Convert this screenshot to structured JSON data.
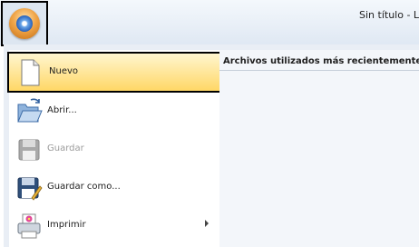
{
  "window": {
    "title": "Sin título - La"
  },
  "app_menu": {
    "recent_header": "Archivos utilizados más recientemente",
    "items": [
      {
        "label": "Nuevo",
        "icon": "new-document-icon",
        "selected": true,
        "enabled": true
      },
      {
        "label": "Abrir...",
        "icon": "open-folder-icon",
        "enabled": true
      },
      {
        "label": "Guardar",
        "icon": "save-disk-icon",
        "enabled": false
      },
      {
        "label": "Guardar como...",
        "icon": "save-as-icon",
        "enabled": true
      },
      {
        "label": "Imprimir",
        "icon": "printer-icon",
        "enabled": true,
        "has_submenu": true
      }
    ]
  },
  "colors": {
    "selection_top": "#fff6cf",
    "selection_bottom": "#ffd766",
    "disabled_text": "#9b9b9b"
  }
}
